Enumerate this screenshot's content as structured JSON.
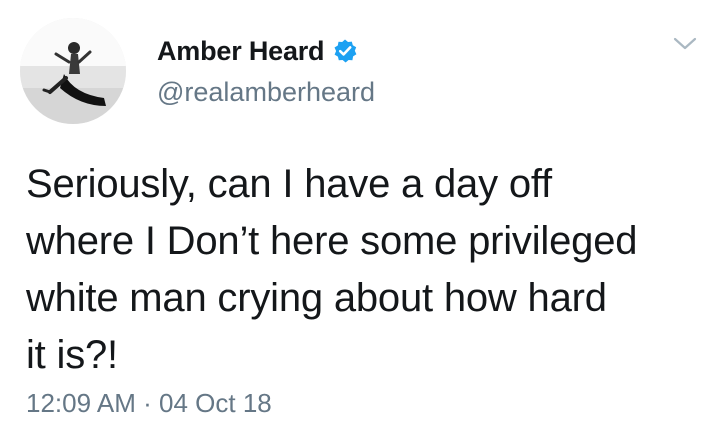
{
  "author": {
    "display_name": "Amber Heard",
    "handle": "@realamberheard",
    "verified": true,
    "verified_color": "#1da1f2"
  },
  "tweet": {
    "lines": [
      "Seriously, can I have a day off",
      "where I Don’t here some privileged",
      "white man crying about how hard",
      "it is?!"
    ],
    "time": "12:09 AM",
    "separator": "·",
    "date": "04 Oct 18"
  },
  "icons": {
    "avatar": "profile-photo",
    "verified": "verified-badge-icon",
    "menu": "chevron-down-icon"
  },
  "colors": {
    "text": "#14171a",
    "secondary": "#657786",
    "chevron": "#aab8c2"
  }
}
